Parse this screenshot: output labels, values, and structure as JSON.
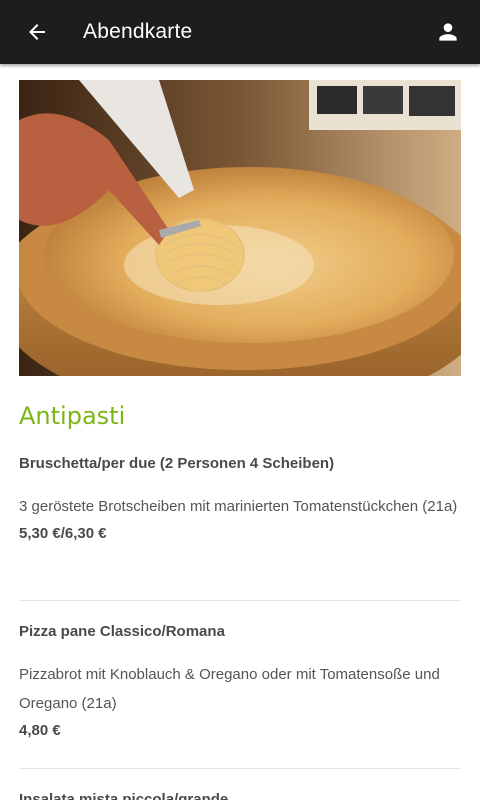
{
  "header": {
    "title": "Abendkarte",
    "back_icon": "arrow-left-icon",
    "user_icon": "person-icon"
  },
  "section": {
    "title": "Antipasti",
    "color": "#7cb518"
  },
  "items": [
    {
      "name": "Bruschetta/per due (2 Personen 4 Scheiben)",
      "description": "3 geröstete Brotscheiben mit marinierten Tomatenstückchen (21a)",
      "price": "5,30 €/6,30 €"
    },
    {
      "name": "Pizza pane Classico/Romana",
      "description": "Pizzabrot mit Knoblauch & Oregano oder mit Tomatensoße und Oregano (21a)",
      "price": "4,80 €"
    },
    {
      "name": "Insalata mista piccola/grande"
    }
  ]
}
